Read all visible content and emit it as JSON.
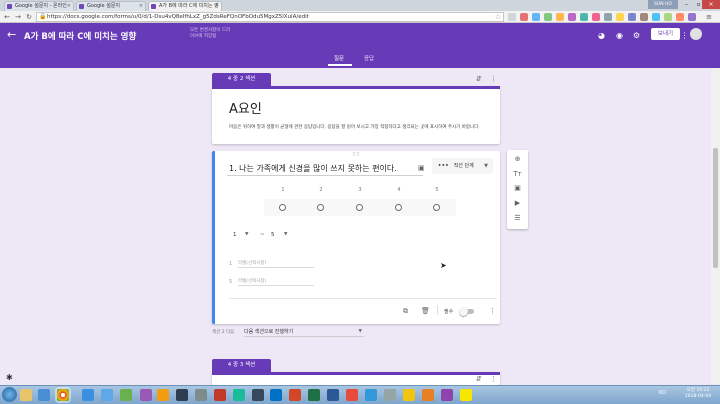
{
  "browser": {
    "tabs": [
      {
        "label": "Google 설문지 - 온라인"
      },
      {
        "label": "Google 설문지"
      },
      {
        "label": "A가 B에 따라 C에 미치는 영"
      }
    ],
    "user_badge": "SUN HO",
    "url": "https://docs.google.com/forms/u/0/d/1-Dsu4vQ8eIfhLxZ_g5ZdsReFQnOFbOdu5MgxZ5lXuiA/edit"
  },
  "form": {
    "title": "A가 B에 따라 C에 미치는 영향",
    "saved_note": "모든 변경사항이 드라이브에 저장됨",
    "send_label": "보내기",
    "tabs": [
      {
        "label": "질문"
      },
      {
        "label": "응답"
      }
    ]
  },
  "section2": {
    "label": "4 중 2 섹션",
    "title": "A요인",
    "description": "마음은 위하여 말과 생활이 균형에 관한 응답입니다. 응답을 잘 읽어 보시고 가장 적합하다고 생각되는 곳에 표시하여 주시기 바랍니다."
  },
  "question": {
    "title": "1. 나는 가족에게 신경을 많이 쓰지  못하는 편이다.",
    "type_label": "직선 단계",
    "scale_numbers": [
      "1",
      "2",
      "3",
      "4",
      "5"
    ],
    "range_min": "1",
    "range_tilde": "~",
    "range_max": "5",
    "label_rows": [
      {
        "num": "1",
        "placeholder": "라벨(선택사항)"
      },
      {
        "num": "5",
        "placeholder": "라벨(선택사항)"
      }
    ],
    "required_label": "필수"
  },
  "after_section": {
    "text": "섹션 2 다음",
    "value": "다음 섹션으로 진행하기"
  },
  "section3": {
    "label": "4 중 3 섹션"
  },
  "taskbar": {
    "lang": "KO",
    "time": "오전 10:22",
    "date": "2018-04-04"
  },
  "colors": {
    "accent": "#673ab7",
    "background": "#ede7f6",
    "focus": "#4285f4"
  }
}
